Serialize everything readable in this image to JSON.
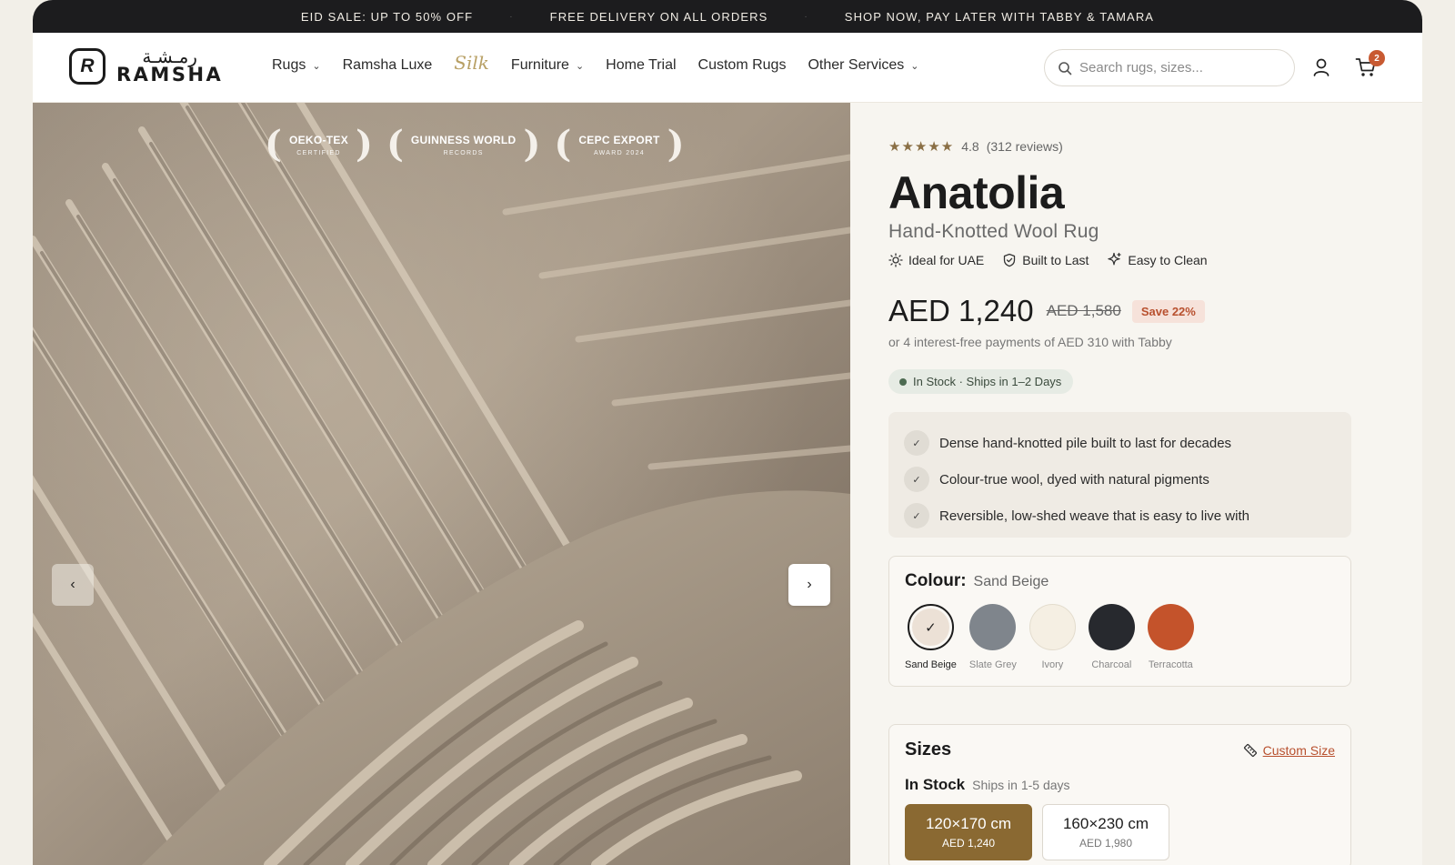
{
  "announcement": {
    "items": [
      "EID SALE: UP TO 50% OFF",
      "FREE DELIVERY ON ALL ORDERS",
      "SHOP NOW, PAY LATER WITH TABBY & TAMARA"
    ],
    "separator": "·"
  },
  "brand": {
    "mark": "R",
    "arabic": "رمـشـة",
    "name": "RAMSHA"
  },
  "nav": {
    "rugs": "Rugs",
    "luxe": "Ramsha Luxe",
    "silk": "Silk",
    "furniture": "Furniture",
    "home_trial": "Home Trial",
    "custom_rugs": "Custom Rugs",
    "other_services": "Other Services",
    "search_placeholder": "Search rugs, sizes...",
    "cart_count": "2"
  },
  "gallery": {
    "awards": [
      {
        "title": "OEKO-TEX",
        "sub": "CERTIFIED"
      },
      {
        "title": "GUINNESS WORLD",
        "sub": "RECORDS"
      },
      {
        "title": "CEPC EXPORT",
        "sub": "AWARD 2024"
      }
    ],
    "prev_icon": "‹",
    "next_icon": "›"
  },
  "product": {
    "stars": "★★★★★",
    "rating": "4.8",
    "reviews": "(312 reviews)",
    "title": "Anatolia",
    "subtitle": "Hand-Knotted Wool Rug",
    "features": [
      "Ideal for UAE",
      "Built to Last",
      "Easy to Clean"
    ],
    "price": "AED 1,240",
    "old_price": "AED 1,580",
    "save": "Save 22%",
    "installments": "or 4 interest-free payments of AED 310 with Tabby",
    "stock": "In Stock · Ships in 1–2 Days",
    "bullets": [
      "Dense hand-knotted pile built to last for decades",
      "Colour-true wool, dyed with natural pigments",
      "Reversible, low-shed weave that is easy to live with"
    ]
  },
  "colour": {
    "label": "Colour:",
    "selected": "Sand Beige",
    "options": [
      {
        "name": "Sand Beige",
        "hex": "#ece1d6"
      },
      {
        "name": "Slate Grey",
        "hex": "#7f858c"
      },
      {
        "name": "Ivory",
        "hex": "#f5efe3"
      },
      {
        "name": "Charcoal",
        "hex": "#27292e"
      },
      {
        "name": "Terracotta",
        "hex": "#c4532b"
      }
    ]
  },
  "sizes": {
    "label": "Sizes",
    "custom": "Custom Size",
    "stock_label": "In Stock",
    "stock_sub": "Ships in 1-5 days",
    "options": [
      {
        "dim": "120×170 cm",
        "price": "AED 1,240"
      },
      {
        "dim": "160×230 cm",
        "price": "AED 1,980"
      }
    ]
  },
  "colors": {
    "accent": "#8a6932",
    "sale": "#c85a32",
    "dark": "#1c1c1e"
  }
}
